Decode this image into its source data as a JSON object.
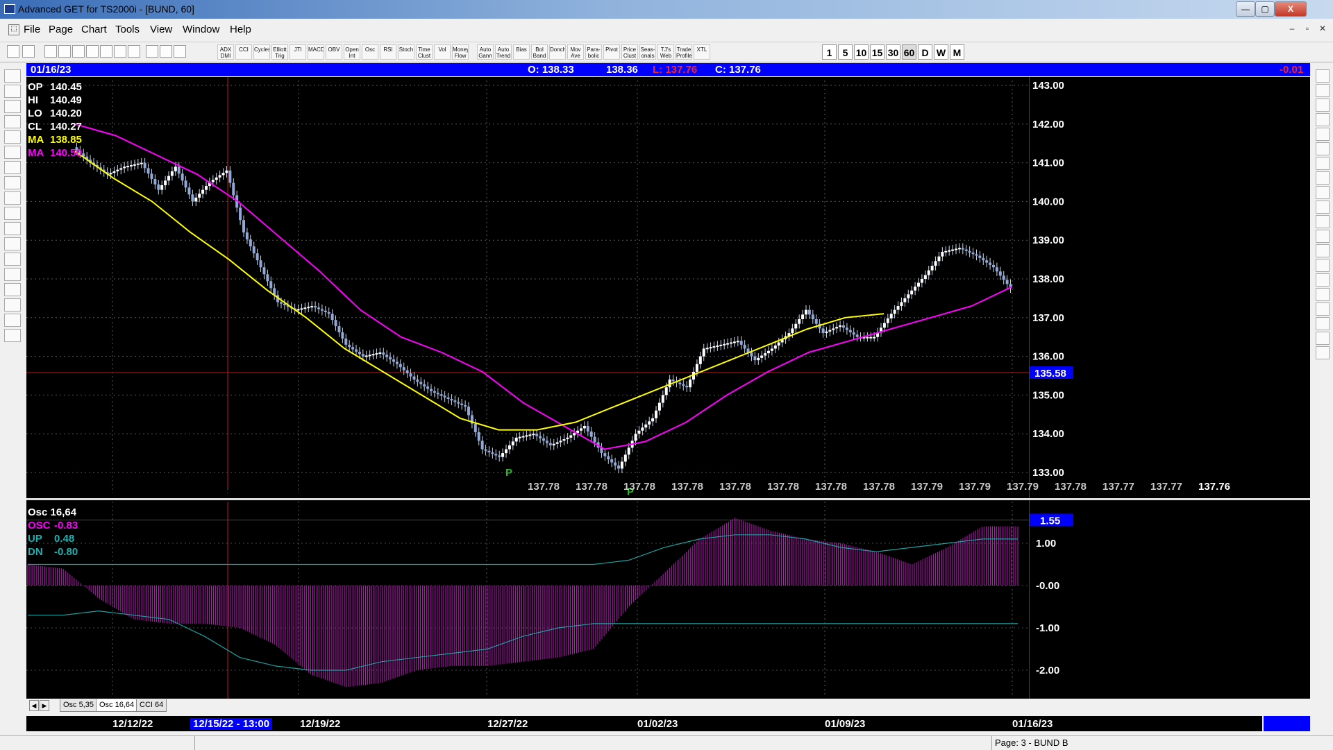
{
  "window": {
    "title": "Advanced GET for TS2000i - [BUND, 60]",
    "minimize_glyph": "—",
    "maximize_glyph": "▢",
    "close_glyph": "X"
  },
  "menu": {
    "items": [
      "File",
      "Page",
      "Chart",
      "Tools",
      "View",
      "Window",
      "Help"
    ],
    "mdi_minimize": "–",
    "mdi_restore": "▫",
    "mdi_close": "✕"
  },
  "toolbar": {
    "study_buttons": [
      "ADX DMI",
      "CCI",
      "Cycles",
      "Elliott Trig",
      "JTI",
      "MACD",
      "OBV",
      "Open Int",
      "Osc",
      "RSI",
      "Stoch",
      "Time Clust",
      "Vol",
      "Money Flow",
      "Auto Gann",
      "Auto Trend",
      "Bias",
      "Bol Band",
      "Donch",
      "Mov Ave",
      "Para-bolic",
      "Pivot",
      "Price Clust",
      "Seas-onals",
      "TJ's Web",
      "Trade Profile",
      "XTL"
    ],
    "timeframes": [
      "1",
      "5",
      "10",
      "15",
      "30",
      "60",
      "D",
      "W",
      "M"
    ],
    "active_timeframe": "60"
  },
  "header": {
    "date": "01/16/23",
    "open": "O: 138.33",
    "high": "138.36",
    "low": "L: 137.76",
    "close": "C: 137.76",
    "change": "-0.01",
    "low_color": "#ff2020",
    "change_color": "#ff2020"
  },
  "price_panel": {
    "readouts": [
      {
        "label": "OP",
        "value": "140.45",
        "color": "#ffffff"
      },
      {
        "label": "HI",
        "value": "140.49",
        "color": "#ffffff"
      },
      {
        "label": "LO",
        "value": "140.20",
        "color": "#ffffff"
      },
      {
        "label": "CL",
        "value": "140.27",
        "color": "#ffffff"
      },
      {
        "label": "MA",
        "value": "138.85",
        "color": "#ffff00"
      },
      {
        "label": "MA",
        "value": "140.50",
        "color": "#ff00ff"
      }
    ],
    "price_ticks": [
      "143.00",
      "142.00",
      "141.00",
      "140.00",
      "139.00",
      "138.00",
      "137.00",
      "136.00",
      "135.00",
      "134.00",
      "133.00"
    ],
    "crosshair_price": "135.58",
    "bottom_values": [
      "137.78",
      "137.78",
      "137.78",
      "137.78",
      "137.78",
      "137.78",
      "137.78",
      "137.78",
      "137.79",
      "137.79",
      "137.79",
      "137.78",
      "137.77",
      "137.77",
      "137.76"
    ],
    "pivot_labels": [
      "P",
      "P"
    ]
  },
  "osc_panel": {
    "title": "Osc 16,64",
    "readouts": [
      {
        "label": "OSC",
        "value": "-0.83",
        "color": "#ff00ff"
      },
      {
        "label": "UP",
        "value": "0.48",
        "color": "#20b0b0"
      },
      {
        "label": "DN",
        "value": "-0.80",
        "color": "#20b0b0"
      }
    ],
    "ticks": [
      "1.00",
      "-0.00",
      "-1.00",
      "-2.00"
    ],
    "crosshair_value": "1.55"
  },
  "tabs": {
    "nav_prev": "◀",
    "nav_next": "▶",
    "items": [
      "Osc 5,35",
      "Osc 16,64",
      "CCI 64"
    ],
    "active": "Osc 16,64"
  },
  "date_axis": {
    "labels": [
      "12/12/22",
      "12/15/22 - 13:00",
      "12/19/22",
      "12/27/22",
      "01/02/23",
      "01/09/23",
      "01/16/23"
    ],
    "highlighted": "12/15/22 - 13:00"
  },
  "status": {
    "page": "Page: 3 - BUND B"
  },
  "chart_data": {
    "type": "candlestick",
    "symbol": "BUND",
    "interval": "60",
    "ylim": [
      133,
      143
    ],
    "x_dates": [
      "12/12/22",
      "12/15/22",
      "12/19/22",
      "12/27/22",
      "01/02/23",
      "01/09/23",
      "01/16/23"
    ],
    "price_path_close": [
      141.4,
      141.0,
      140.7,
      140.9,
      141.0,
      140.3,
      140.9,
      140.0,
      140.5,
      140.8,
      139.2,
      138.3,
      137.4,
      137.2,
      137.3,
      137.1,
      136.3,
      136.0,
      136.1,
      135.8,
      135.4,
      135.1,
      134.9,
      134.7,
      133.6,
      133.4,
      133.9,
      134.0,
      133.7,
      133.9,
      134.2,
      133.5,
      133.1,
      134.0,
      134.4,
      135.4,
      135.2,
      136.2,
      136.3,
      136.4,
      135.9,
      136.2,
      136.6,
      137.2,
      136.6,
      136.8,
      136.5,
      136.5,
      137.1,
      137.6,
      138.1,
      138.7,
      138.8,
      138.6,
      138.3,
      137.76
    ],
    "ma_yellow": [
      141.3,
      140.6,
      140.0,
      139.2,
      138.5,
      137.7,
      137.0,
      136.2,
      135.6,
      135.0,
      134.4,
      134.1,
      134.1,
      134.3,
      134.7,
      135.1,
      135.5,
      135.9,
      136.3,
      136.7,
      137.0,
      137.1
    ],
    "ma_magenta": [
      142.0,
      141.7,
      141.2,
      140.7,
      140.0,
      139.1,
      138.2,
      137.2,
      136.5,
      136.1,
      135.6,
      134.8,
      134.2,
      133.6,
      133.8,
      134.3,
      135.0,
      135.6,
      136.1,
      136.4,
      136.7,
      137.0,
      137.3,
      137.8
    ],
    "osc_histogram": [
      0.5,
      0.4,
      -0.3,
      -0.8,
      -0.9,
      -0.9,
      -1.0,
      -1.4,
      -2.1,
      -2.4,
      -2.3,
      -2.0,
      -1.9,
      -1.9,
      -1.8,
      -1.7,
      -1.5,
      -0.5,
      0.3,
      1.1,
      1.6,
      1.3,
      1.1,
      1.0,
      0.8,
      0.5,
      0.9,
      1.4,
      1.4
    ],
    "up_line": [
      0.5,
      0.5,
      0.5,
      0.5,
      0.5,
      0.5,
      0.5,
      0.5,
      0.5,
      0.5,
      0.5,
      0.5,
      0.5,
      0.5,
      0.5,
      0.5,
      0.5,
      0.6,
      0.9,
      1.1,
      1.2,
      1.2,
      1.1,
      0.9,
      0.8,
      0.9,
      1.0,
      1.1,
      1.1
    ],
    "dn_line": [
      -0.7,
      -0.7,
      -0.6,
      -0.7,
      -0.8,
      -1.2,
      -1.7,
      -1.9,
      -2.0,
      -2.0,
      -1.8,
      -1.7,
      -1.6,
      -1.5,
      -1.2,
      -1.0,
      -0.9,
      -0.9,
      -0.9,
      -0.9,
      -0.9,
      -0.9,
      -0.9,
      -0.9,
      -0.9,
      -0.9,
      -0.9,
      -0.9,
      -0.9
    ]
  }
}
